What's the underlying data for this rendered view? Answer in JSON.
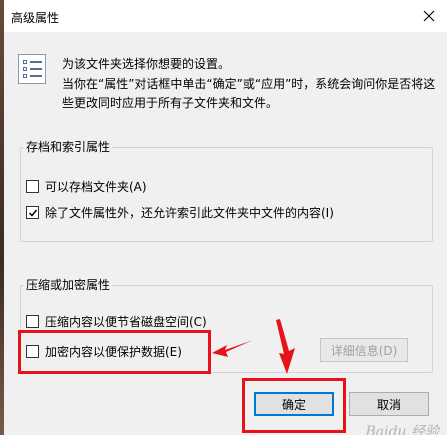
{
  "window": {
    "title": "高级属性"
  },
  "description": {
    "line1": "为该文件夹选择你想要的设置。",
    "line2": "当你在“属性”对话框中单击“确定”或“应用”时，系统会询问你是否将这些更改同时应用于所有子文件夹和文件。"
  },
  "archive_index": {
    "title": "存档和索引属性",
    "options": [
      {
        "label": "可以存档文件夹(A)",
        "checked": false
      },
      {
        "label": "除了文件属性外，还允许索引此文件夹中文件的内容(I)",
        "checked": true
      }
    ]
  },
  "compress_encrypt": {
    "title": "压缩或加密属性",
    "options": [
      {
        "label": "压缩内容以便节省磁盘空间(C)",
        "checked": false
      },
      {
        "label": "加密内容以便保护数据(E)",
        "checked": false
      }
    ],
    "details_button": "详细信息(D)"
  },
  "buttons": {
    "ok": "确定",
    "cancel": "取消"
  },
  "watermark": "Baidu 经验",
  "colors": {
    "annotation": "#e8131a",
    "focus": "#0078d7"
  }
}
